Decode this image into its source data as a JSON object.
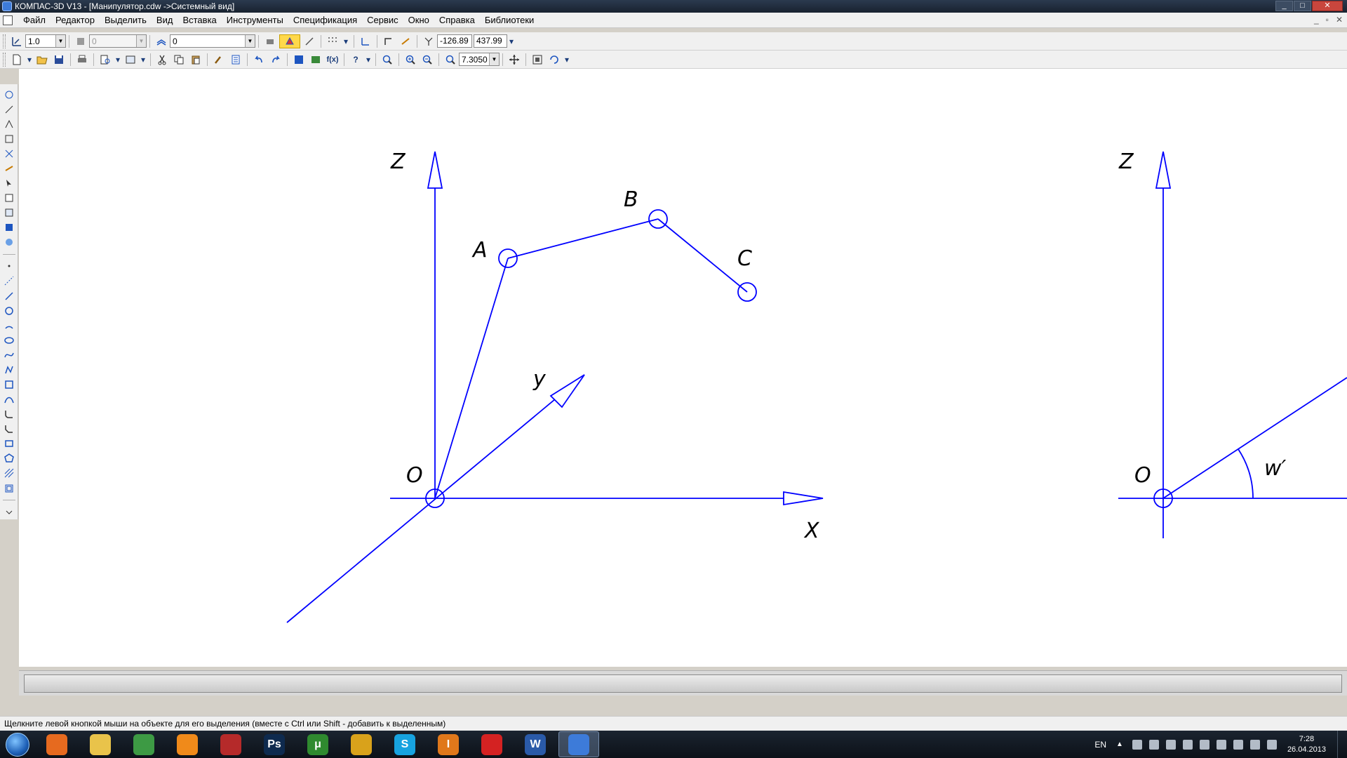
{
  "window": {
    "title": "КОМПАС-3D V13 - [Манипулятор.cdw ->Системный вид]",
    "controls": [
      "_",
      "□",
      "✕"
    ]
  },
  "menu": [
    "Файл",
    "Редактор",
    "Выделить",
    "Вид",
    "Вставка",
    "Инструменты",
    "Спецификация",
    "Сервис",
    "Окно",
    "Справка",
    "Библиотеки"
  ],
  "toolbar1": {
    "step_value": "1.0",
    "layer_combo_value": "0",
    "state_combo_value": "0",
    "coord_x": "-126.89",
    "coord_y": "437.99"
  },
  "toolbar2": {
    "zoom_value": "7.3050"
  },
  "drawing": {
    "labels": {
      "z_left": "Z",
      "a": "A",
      "b": "B",
      "c": "C",
      "y": "y",
      "o_left": "O",
      "x": "X",
      "z_right": "Z",
      "o_right": "O",
      "w": "w′"
    },
    "stroke_color": "#0000ff"
  },
  "status": {
    "text": "Щелкните левой кнопкой мыши на объекте для его выделения (вместе с Ctrl или Shift - добавить к выделенным)"
  },
  "taskbar": {
    "apps": [
      {
        "name": "firefox",
        "label": "",
        "color": "#e66a1f"
      },
      {
        "name": "explorer",
        "label": "",
        "color": "#e9c34a"
      },
      {
        "name": "utility",
        "label": "",
        "color": "#3d9a44"
      },
      {
        "name": "winamp",
        "label": "",
        "color": "#f08a1a"
      },
      {
        "name": "red-app",
        "label": "",
        "color": "#b52a2a"
      },
      {
        "name": "photoshop",
        "label": "Ps",
        "color": "#0e2a4e"
      },
      {
        "name": "utorrent",
        "label": "μ",
        "color": "#2f8a2f"
      },
      {
        "name": "chrome",
        "label": "",
        "color": "#d9a21b"
      },
      {
        "name": "skype",
        "label": "S",
        "color": "#17a3e0"
      },
      {
        "name": "orange-app",
        "label": "I",
        "color": "#e0781b"
      },
      {
        "name": "red-splash",
        "label": "",
        "color": "#d42222"
      },
      {
        "name": "word",
        "label": "W",
        "color": "#2a5aa8"
      },
      {
        "name": "kompas",
        "label": "",
        "color": "#3d7bd9"
      }
    ],
    "lang": "EN",
    "time": "7:28",
    "date": "26.04.2013"
  }
}
